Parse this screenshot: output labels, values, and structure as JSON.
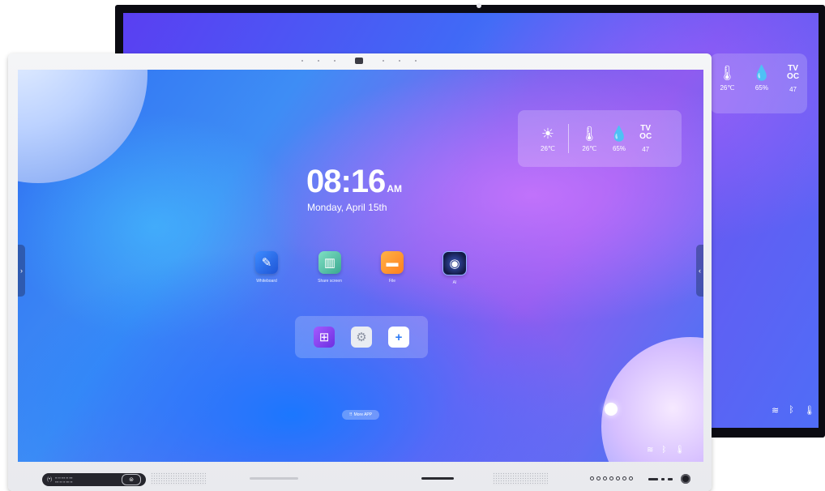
{
  "weather": {
    "outdoor_temp": "26℃",
    "indoor_temp": "26℃",
    "humidity": "65%",
    "tvoc_label": "TV\nOC",
    "tvoc_value": "47",
    "icons": [
      "sun-icon",
      "thermometer-icon",
      "droplet-icon",
      "tvoc-icon"
    ]
  },
  "back_weather": {
    "indoor_temp": "26℃",
    "humidity": "65%",
    "tvoc_label": "TV\nOC",
    "tvoc_value": "47"
  },
  "clock": {
    "time": "08:16",
    "ampm": "AM",
    "date": "Monday, April 15th"
  },
  "apps": [
    {
      "label": "Whiteboard",
      "icon": "pen-icon",
      "color": "#2f6fe8"
    },
    {
      "label": "Share screen",
      "icon": "share-screen-icon",
      "color": "#5fc3a8"
    },
    {
      "label": "File",
      "icon": "folder-icon",
      "color": "#ff9a2e"
    },
    {
      "label": "AI",
      "icon": "ai-icon",
      "color": "#1a2a66"
    }
  ],
  "dock": [
    {
      "name": "windows",
      "icon": "windows-icon",
      "color": "#8a3ff0"
    },
    {
      "name": "settings",
      "icon": "gear-icon",
      "color": "#dfe3ea"
    },
    {
      "name": "add",
      "icon": "plus-icon",
      "color": "#2f7bf5"
    }
  ],
  "more_app_label": "More APP",
  "colors": {
    "screen_blue": "#3e8df5",
    "screen_purple": "#8f5cf0",
    "bezel": "#eeeff2"
  }
}
